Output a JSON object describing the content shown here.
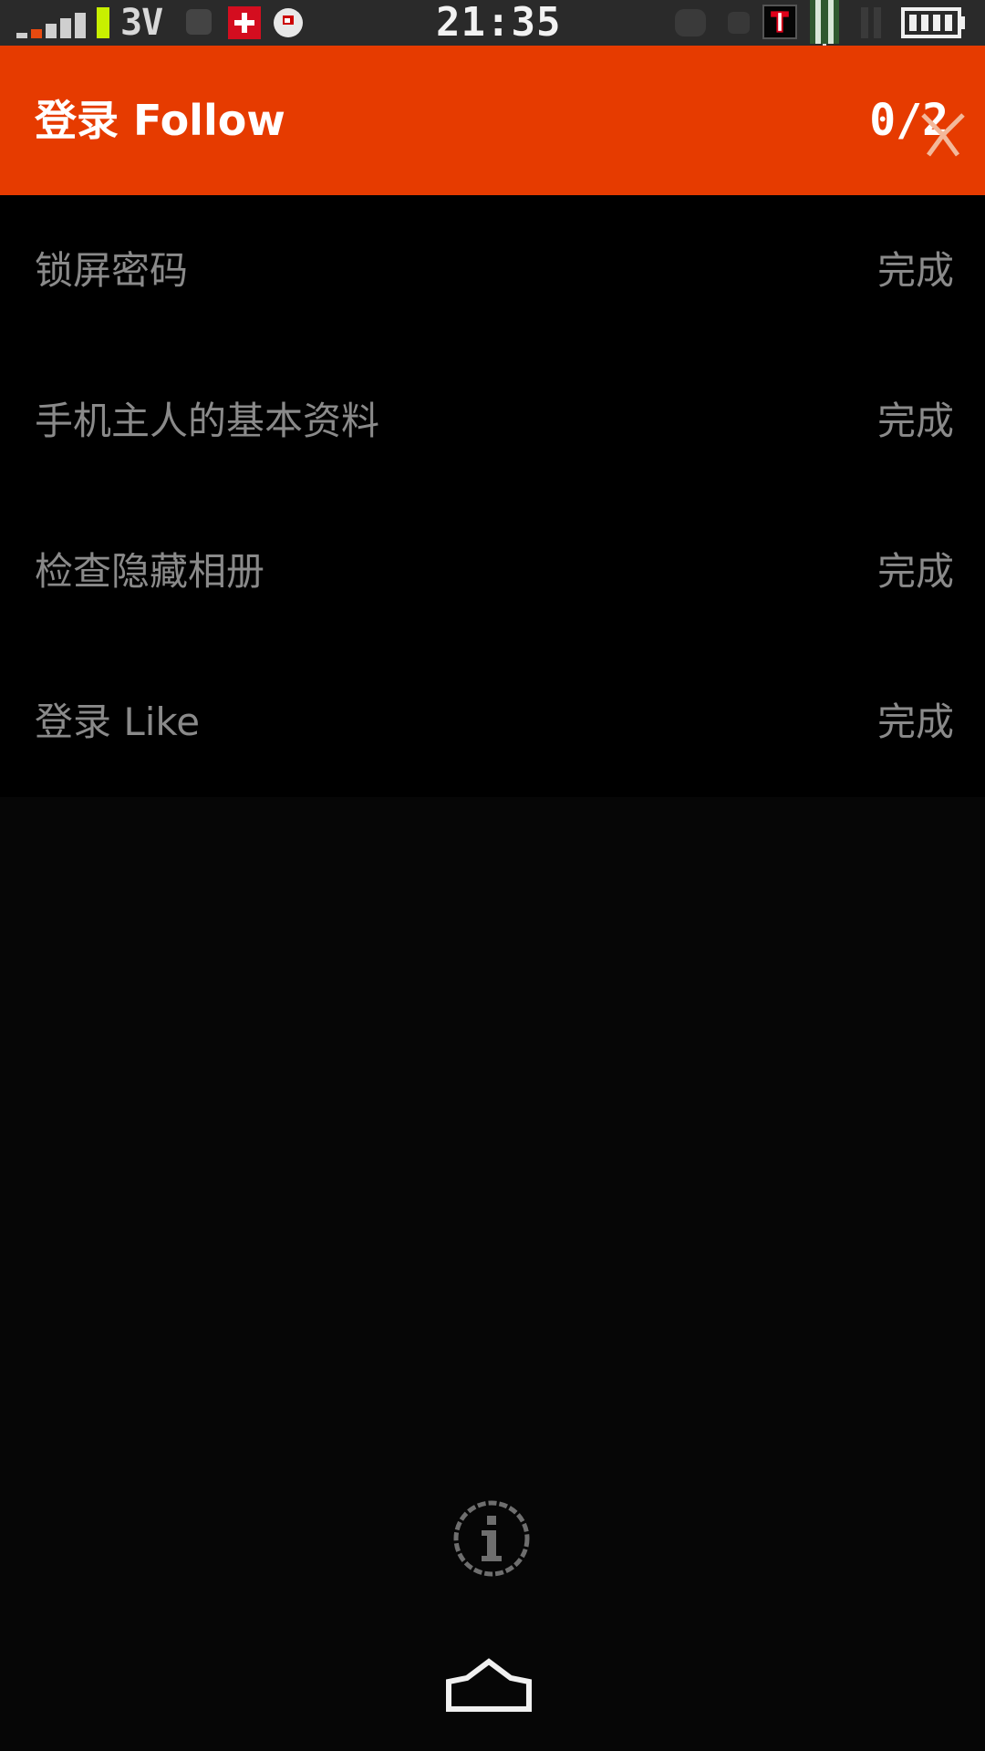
{
  "status_bar": {
    "network_label": "3V",
    "time": "21:35",
    "icons": [
      "signal-icon",
      "network-icon",
      "swiss-flag-icon",
      "clock-app-icon",
      "notification-icon",
      "t-app-icon",
      "medal-icon",
      "pause-icon",
      "battery-icon"
    ]
  },
  "app_bar": {
    "title": "登录 Follow",
    "counter": "0/2",
    "color": "#e63b00"
  },
  "tasks": [
    {
      "label": "锁屏密码",
      "status": "完成"
    },
    {
      "label": "手机主人的基本资料",
      "status": "完成"
    },
    {
      "label": "检查隐藏相册",
      "status": "完成"
    },
    {
      "label": "登录 Like",
      "status": "完成"
    }
  ],
  "bottom": {
    "info_icon": "info-icon",
    "home_icon": "home-icon"
  }
}
